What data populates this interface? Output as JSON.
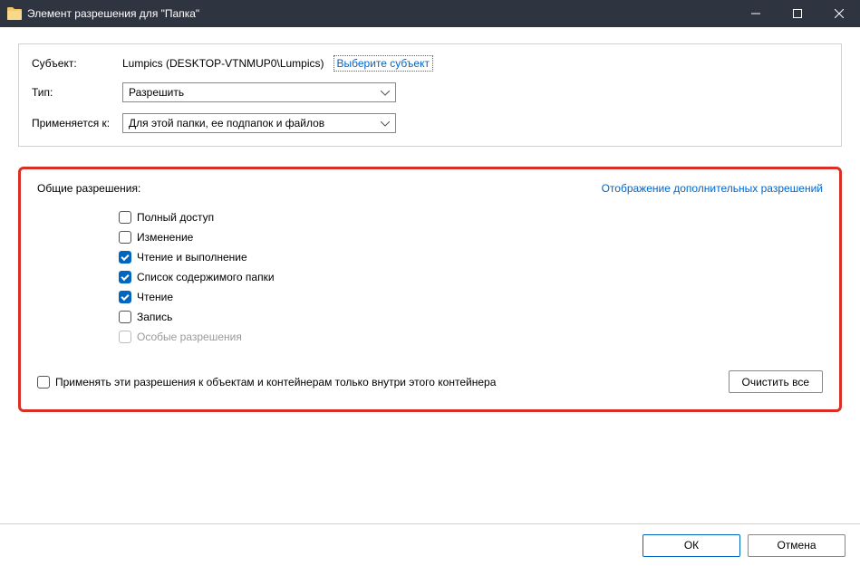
{
  "window": {
    "title": "Элемент разрешения для \"Папка\""
  },
  "top": {
    "subject_label": "Субъект:",
    "subject_value": "Lumpics (DESKTOP-VTNMUP0\\Lumpics)",
    "select_subject_link": "Выберите субъект",
    "type_label": "Тип:",
    "type_value": "Разрешить",
    "applies_label": "Применяется к:",
    "applies_value": "Для этой папки, ее подпапок и файлов"
  },
  "perm": {
    "header_left": "Общие разрешения:",
    "header_right": "Отображение дополнительных разрешений",
    "items": [
      {
        "label": "Полный доступ",
        "checked": false,
        "disabled": false
      },
      {
        "label": "Изменение",
        "checked": false,
        "disabled": false
      },
      {
        "label": "Чтение и выполнение",
        "checked": true,
        "disabled": false
      },
      {
        "label": "Список содержимого папки",
        "checked": true,
        "disabled": false
      },
      {
        "label": "Чтение",
        "checked": true,
        "disabled": false
      },
      {
        "label": "Запись",
        "checked": false,
        "disabled": false
      },
      {
        "label": "Особые разрешения",
        "checked": false,
        "disabled": true
      }
    ],
    "apply_only_label": "Применять эти разрешения к объектам и контейнерам только внутри этого контейнера",
    "apply_only_checked": false,
    "clear_all": "Очистить все"
  },
  "footer": {
    "ok": "ОК",
    "cancel": "Отмена"
  }
}
